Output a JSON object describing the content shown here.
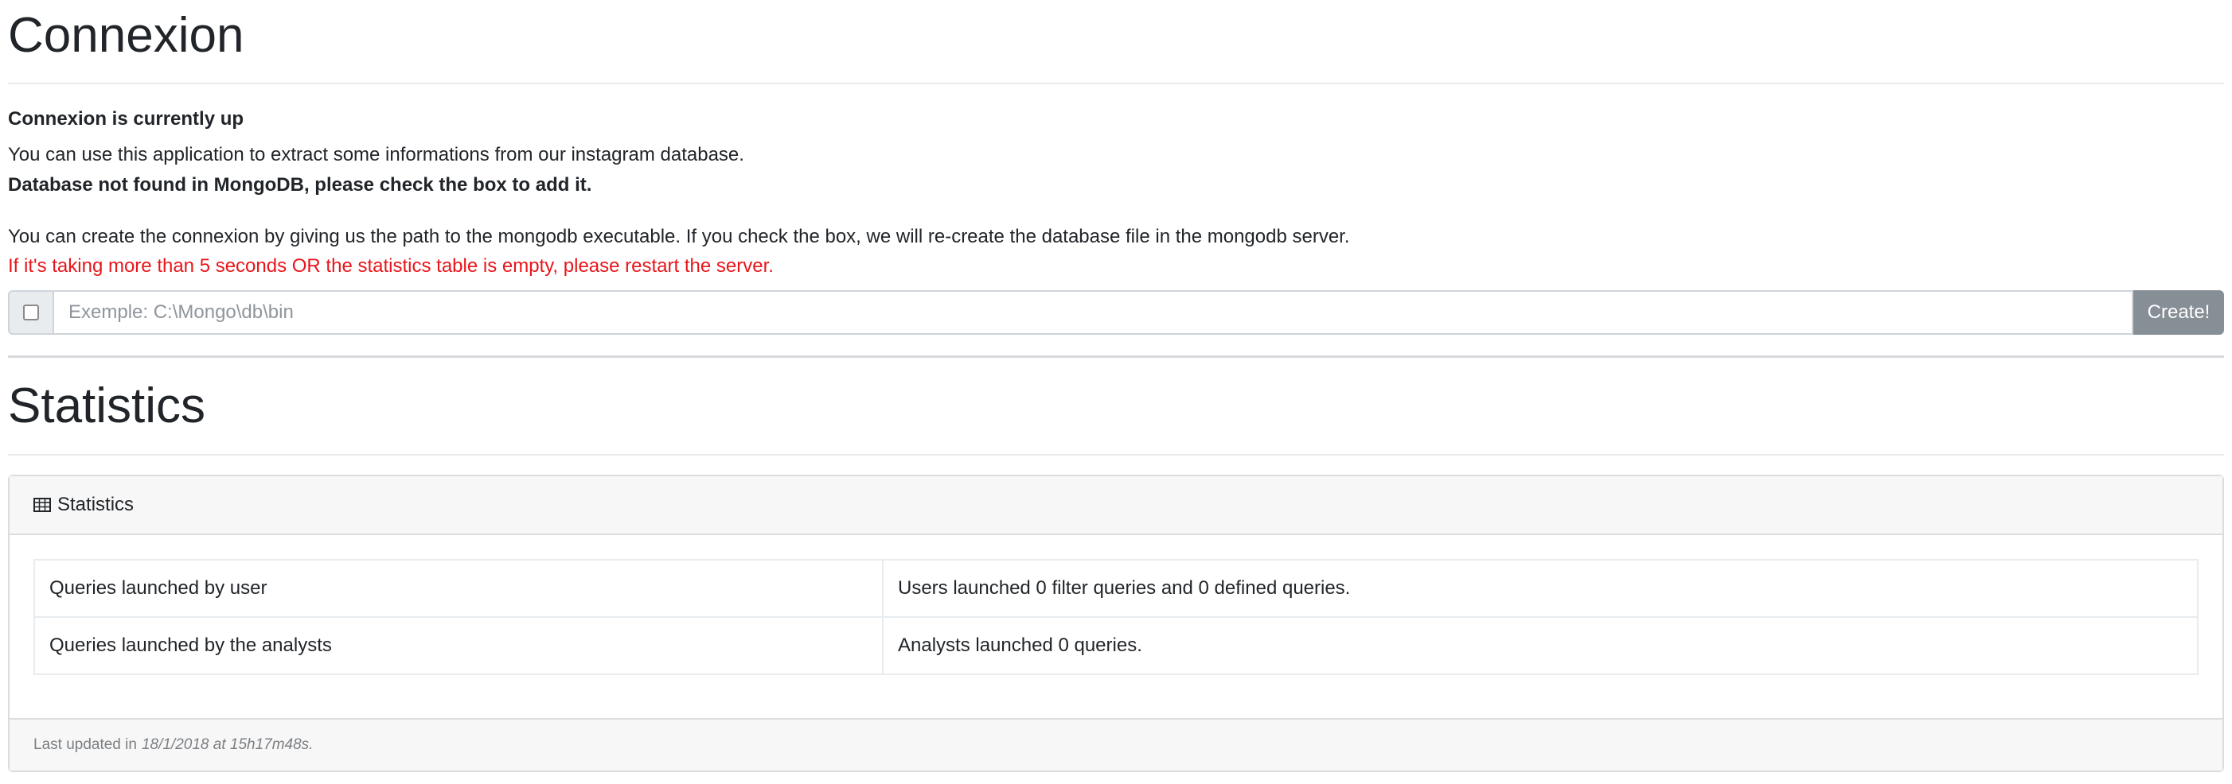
{
  "connexion": {
    "title": "Connexion",
    "status": "Connexion is currently up",
    "intro": "You can use this application to extract some informations from our instagram database.",
    "db_warning": "Database not found in MongoDB, please check the box to add it.",
    "instructions": "You can create the connexion by giving us the path to the mongodb executable. If you check the box, we will re-create the database file in the mongodb server.",
    "restart_warning": "If it's taking more than 5 seconds OR the statistics table is empty, please restart the server.",
    "path_input": {
      "placeholder": "Exemple: C:\\Mongo\\db\\bin",
      "value": ""
    },
    "create_label": "Create!"
  },
  "statistics": {
    "title": "Statistics",
    "card_header": "Statistics",
    "rows": [
      {
        "label": "Queries launched by user",
        "value": "Users launched 0 filter queries and 0 defined queries."
      },
      {
        "label": "Queries launched by the analysts",
        "value": "Analysts launched 0 queries."
      }
    ],
    "footer_prefix": "Last updated in",
    "footer_date": "18/1/2018 at 15h17m48s."
  },
  "icons": {
    "checkbox": "checkbox-icon",
    "table": "table-icon"
  },
  "colors": {
    "warning": "#e8161b",
    "button": "#868e96",
    "card_bg": "#f7f7f7"
  }
}
